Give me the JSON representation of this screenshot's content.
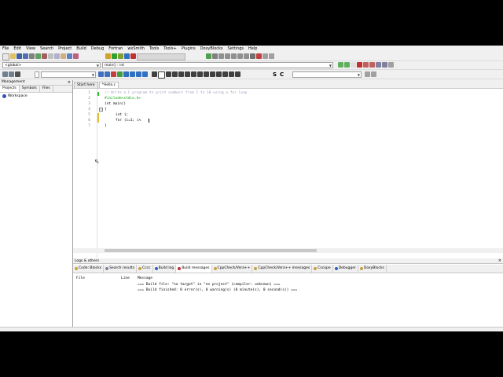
{
  "menu": [
    "File",
    "Edit",
    "View",
    "Search",
    "Project",
    "Build",
    "Debug",
    "Fortran",
    "wxSmith",
    "Tools",
    "Tools+",
    "Plugins",
    "DoxyBlocks",
    "Settings",
    "Help"
  ],
  "toolbar": {
    "scope_combo": "<global>",
    "function_combo": "main() : int",
    "search_combo": "",
    "bold_s": "S",
    "bold_c": "C"
  },
  "management": {
    "title": "Management",
    "tabs": [
      "Projects",
      "Symbols",
      "Files"
    ],
    "workspace_label": "Workspace"
  },
  "editor": {
    "tabs": [
      "Start here",
      "*Hello.c"
    ],
    "lines": [
      {
        "n": "1",
        "text": "// Write a C program to print numbers from 1 to 10 using a for loop"
      },
      {
        "n": "2",
        "text": "#include<stdio.h>"
      },
      {
        "n": "3",
        "text": "int main()"
      },
      {
        "n": "4",
        "text": "{"
      },
      {
        "n": "5",
        "text": "int i;"
      },
      {
        "n": "6",
        "text": "for (i=1; i<"
      },
      {
        "n": "7",
        "text": "}"
      }
    ]
  },
  "logs": {
    "title": "Logs & others",
    "tabs": [
      "Code::Blocks",
      "Search results",
      "Cccc",
      "Build log",
      "Build messages",
      "CppCheck/Vera++",
      "CppCheck/Vera++ messages",
      "Cscope",
      "Debugger",
      "DoxyBlocks"
    ],
    "columns": {
      "file": "File",
      "line": "Line",
      "message": "Message"
    },
    "messages": [
      "=== Build file: \"no target\" in \"no project\" (compiler: unknown) ===",
      "=== Build finished: 0 error(s), 0 warning(s) (0 minute(s), 0 second(s)) ==="
    ]
  },
  "colors": {
    "accent": "#0000a0",
    "comment": "#a0a0c0",
    "preprocessor": "#00a000"
  }
}
